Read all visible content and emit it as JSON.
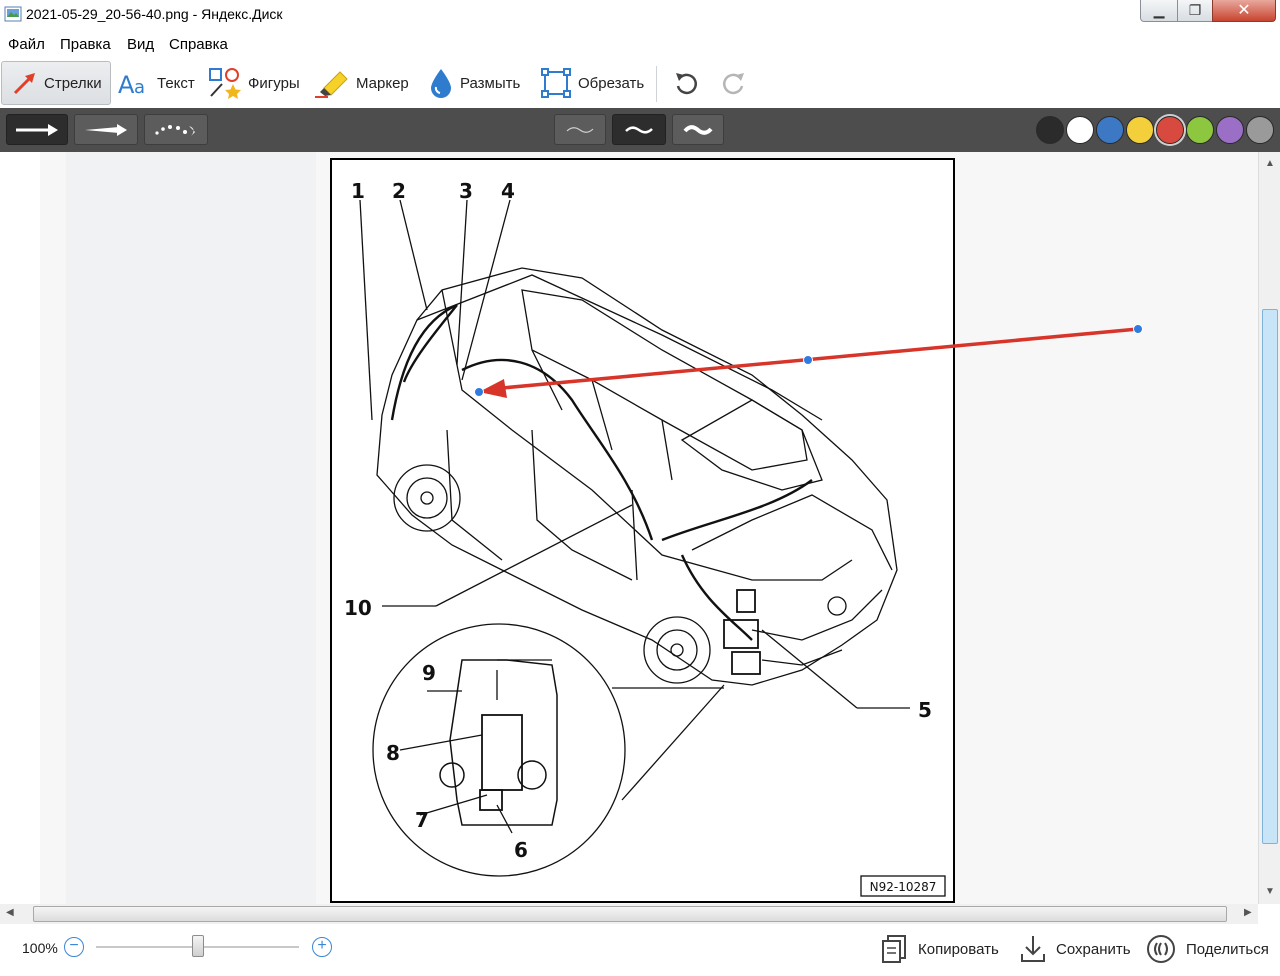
{
  "window": {
    "title": "2021-05-29_20-56-40.png - Яндекс.Диск",
    "minimize_glyph": "▁",
    "maximize_glyph": "❐",
    "close_glyph": "✕"
  },
  "menu": [
    "Файл",
    "Правка",
    "Вид",
    "Справка"
  ],
  "toolbar": {
    "tools": [
      {
        "label": "Стрелки",
        "icon": "arrow-icon",
        "active": true
      },
      {
        "label": "Текст",
        "icon": "text-icon",
        "active": false
      },
      {
        "label": "Фигуры",
        "icon": "shapes-icon",
        "active": false
      },
      {
        "label": "Маркер",
        "icon": "marker-icon",
        "active": false
      },
      {
        "label": "Размыть",
        "icon": "blur-drop-icon",
        "active": false
      },
      {
        "label": "Обрезать",
        "icon": "crop-icon",
        "active": false
      }
    ],
    "undo_icon": "undo-icon",
    "redo_icon": "redo-icon"
  },
  "subtoolbar": {
    "arrow_styles": [
      "arrow-style-solid",
      "arrow-style-tapered",
      "arrow-style-dotted"
    ],
    "line_thickness": [
      "thin",
      "medium",
      "thick"
    ],
    "selected_thickness": "medium",
    "colors": [
      "#2b2b2b",
      "#ffffff",
      "#3c78c3",
      "#f2cf3b",
      "#d84a3f",
      "#8dc63f",
      "#9b6fc6",
      "#9a9a9a"
    ],
    "selected_color": "#d84a3f"
  },
  "diagram": {
    "callouts": [
      "1",
      "2",
      "3",
      "4",
      "5",
      "6",
      "7",
      "8",
      "9",
      "10"
    ],
    "reference_code": "N92-10287"
  },
  "annotation": {
    "color": "#d8352a",
    "handle_color": "#2f7be0"
  },
  "statusbar": {
    "zoom": "100%",
    "zoom_level": 0.5,
    "zoom_out_glyph": "−",
    "zoom_in_glyph": "+",
    "actions": [
      {
        "label": "Копировать",
        "icon": "copy-icon"
      },
      {
        "label": "Сохранить",
        "icon": "download-icon"
      },
      {
        "label": "Поделиться",
        "icon": "share-icon"
      }
    ]
  }
}
